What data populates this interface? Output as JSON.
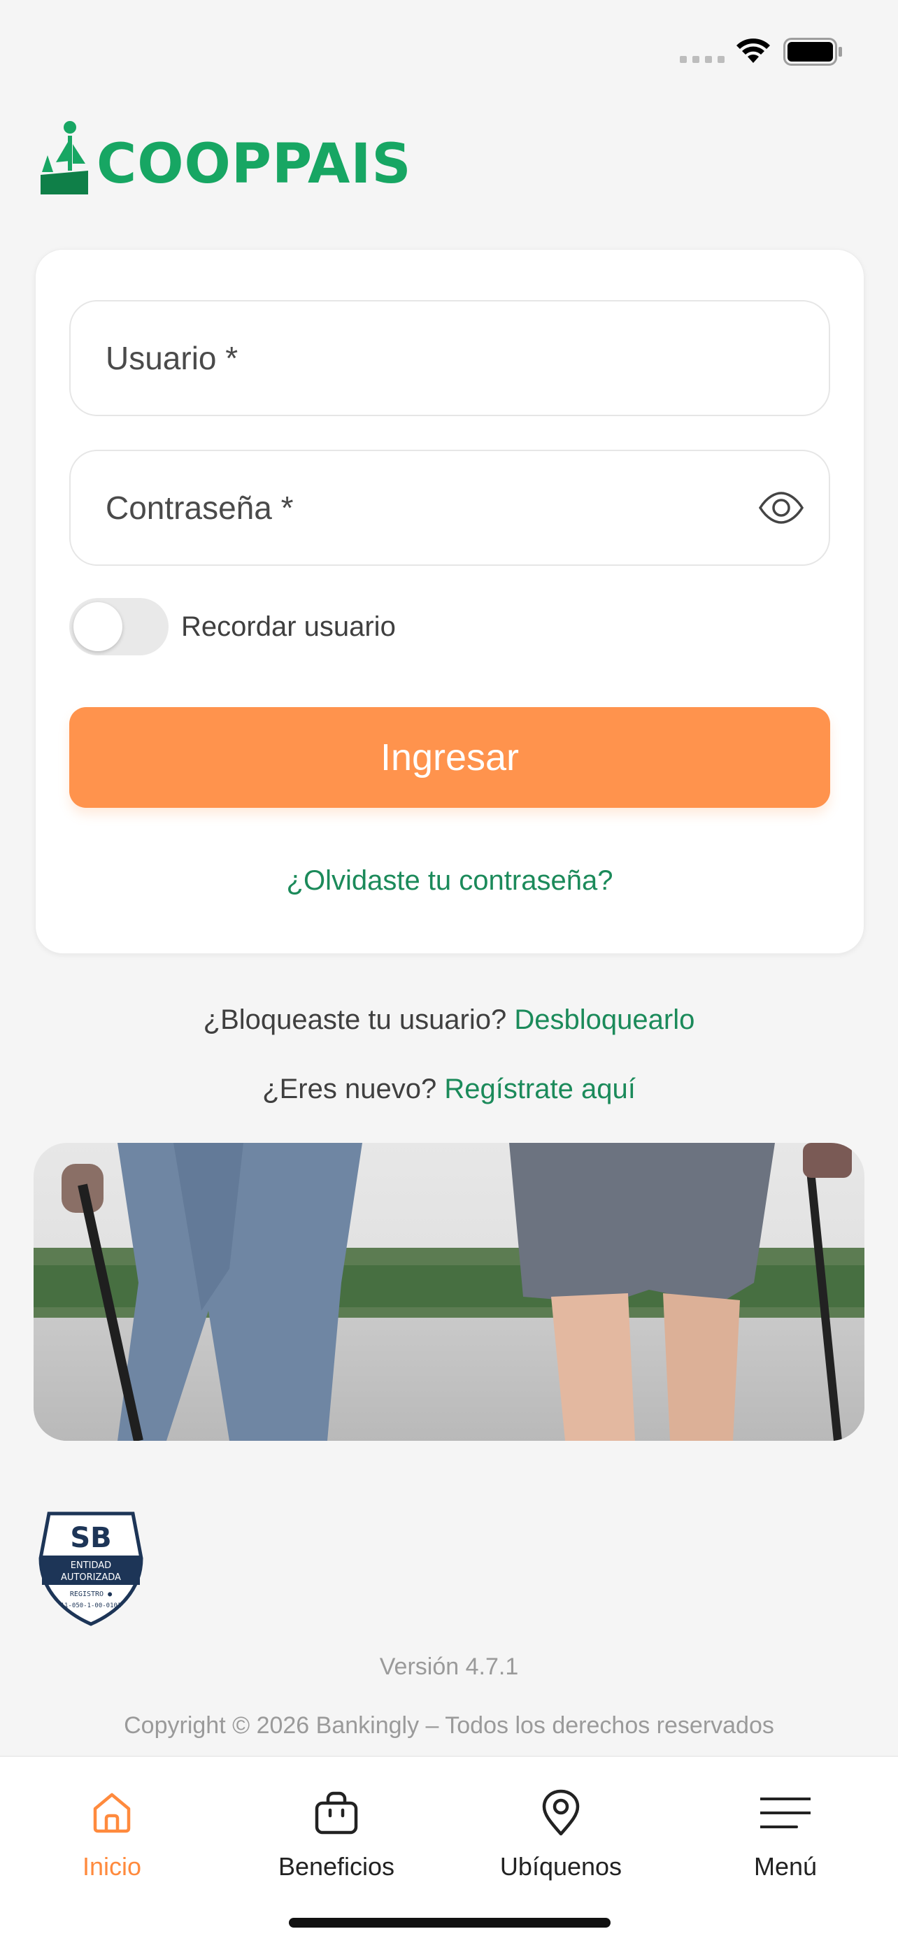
{
  "app": {
    "brand_name": "COOPPAIS",
    "accent_color": "#ff934d",
    "brand_color": "#17a663",
    "link_color": "#1b8a5a"
  },
  "status_bar": {
    "icons": [
      "signal-icon",
      "wifi-icon",
      "battery-icon"
    ]
  },
  "login": {
    "username_label": "Usuario *",
    "password_label": "Contraseña *",
    "remember_label": "Recordar usuario",
    "remember_checked": false,
    "submit_label": "Ingresar",
    "forgot_label": "¿Olvidaste tu contraseña?"
  },
  "unlock": {
    "prompt": "¿Bloqueaste tu usuario?",
    "link": "Desbloquearlo"
  },
  "register": {
    "prompt": "¿Eres nuevo?",
    "link": "Regístrate aquí"
  },
  "badge": {
    "top": "SB",
    "line1": "ENTIDAD",
    "line2": "AUTORIZADA",
    "line3": "REGISTRO ●",
    "line4": "11-050-1-00-0101"
  },
  "footer": {
    "version": "Versión 4.7.1",
    "copyright": "Copyright © 2026 Bankingly – Todos los derechos reservados"
  },
  "bottom_nav": {
    "items": [
      {
        "label": "Inicio",
        "icon": "home-icon",
        "active": true
      },
      {
        "label": "Beneficios",
        "icon": "bag-icon",
        "active": false
      },
      {
        "label": "Ubíquenos",
        "icon": "location-pin-icon",
        "active": false
      },
      {
        "label": "Menú",
        "icon": "hamburger-menu-icon",
        "active": false
      }
    ]
  }
}
